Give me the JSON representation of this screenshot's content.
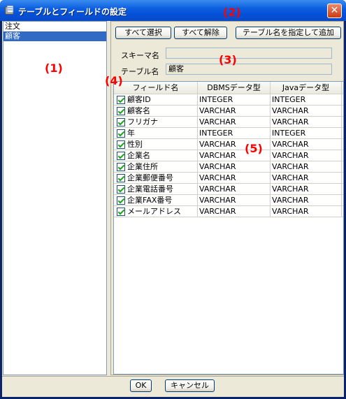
{
  "window": {
    "title": "テーブルとフィールドの設定",
    "close_glyph": "✕"
  },
  "tables": [
    "注文",
    "顧客"
  ],
  "toolbar": {
    "select_all": "すべて選択",
    "deselect_all": "すべて解除",
    "add_by_name": "テーブル名を指定して追加"
  },
  "schema": {
    "label": "スキーマ名",
    "value": ""
  },
  "table_name": {
    "label": "テーブル名",
    "value": "顧客"
  },
  "grid": {
    "headers": [
      "フィールド名",
      "DBMSデータ型",
      "Javaデータ型"
    ],
    "rows": [
      {
        "field": "顧客ID",
        "dbms": "INTEGER",
        "java": "INTEGER"
      },
      {
        "field": "顧客名",
        "dbms": "VARCHAR",
        "java": "VARCHAR"
      },
      {
        "field": "フリガナ",
        "dbms": "VARCHAR",
        "java": "VARCHAR"
      },
      {
        "field": "年",
        "dbms": "INTEGER",
        "java": "INTEGER"
      },
      {
        "field": "性別",
        "dbms": "VARCHAR",
        "java": "VARCHAR"
      },
      {
        "field": "企業名",
        "dbms": "VARCHAR",
        "java": "VARCHAR"
      },
      {
        "field": "企業住所",
        "dbms": "VARCHAR",
        "java": "VARCHAR"
      },
      {
        "field": "企業郵便番号",
        "dbms": "VARCHAR",
        "java": "VARCHAR"
      },
      {
        "field": "企業電話番号",
        "dbms": "VARCHAR",
        "java": "VARCHAR"
      },
      {
        "field": "企業FAX番号",
        "dbms": "VARCHAR",
        "java": "VARCHAR"
      },
      {
        "field": "メールアドレス",
        "dbms": "VARCHAR",
        "java": "VARCHAR"
      }
    ]
  },
  "footer": {
    "ok": "OK",
    "cancel": "キャンセル"
  },
  "annotations": [
    "(1)",
    "(2)",
    "(3)",
    "(4)",
    "(5)"
  ],
  "colors": {
    "annotation": "#ff0000",
    "selection": "#316ac5",
    "titlebar": "#0450d8"
  }
}
